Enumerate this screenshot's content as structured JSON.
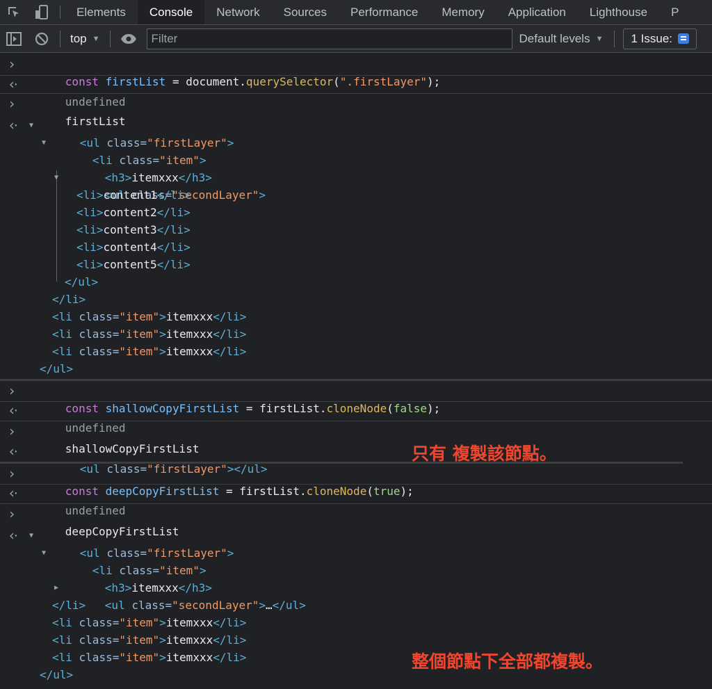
{
  "tabs": [
    {
      "id": "elements",
      "label": "Elements"
    },
    {
      "id": "console",
      "label": "Console"
    },
    {
      "id": "network",
      "label": "Network"
    },
    {
      "id": "sources",
      "label": "Sources"
    },
    {
      "id": "performance",
      "label": "Performance"
    },
    {
      "id": "memory",
      "label": "Memory"
    },
    {
      "id": "application",
      "label": "Application"
    },
    {
      "id": "lighthouse",
      "label": "Lighthouse"
    },
    {
      "id": "more",
      "label": "P"
    }
  ],
  "toolbar": {
    "context": "top",
    "filter_placeholder": "Filter",
    "levels": "Default levels",
    "issues": "1 Issue:"
  },
  "code": {
    "const": "const",
    "eq": " = ",
    "doc": "document",
    "dot": ".",
    "qs": "querySelector",
    "open": "(",
    "close": ");",
    "firstLayerStr": "\".firstLayer\"",
    "firstList": "firstList",
    "shallow": "shallowCopyFirstList",
    "deep": "deepCopyFirstList",
    "cloneNode": "cloneNode",
    "false": "false",
    "true": "true",
    "undefined": "undefined"
  },
  "dom": {
    "ul_open": "<ul",
    "li_open": "<li",
    "h3_open": "<h3>",
    "h3_close": "</h3>",
    "class_attr": " class=",
    "gt": ">",
    "ul_close": "</ul>",
    "li_close": "</li>",
    "li_simple": "<li>",
    "firstLayer": "\"firstLayer\"",
    "item": "\"item\"",
    "secondLayer": "\"secondLayer\"",
    "itemxxx": "itemxxx",
    "ellipsis": "…",
    "contents": [
      "content1",
      "content2",
      "content3",
      "content4",
      "content5"
    ]
  },
  "annotations": {
    "shallow": "只有 複製該節點。",
    "deep": "整個節點下全部都複製。"
  },
  "colors": {
    "tag": "#5db0d7",
    "attr": "#9bbbdc",
    "value": "#f29766",
    "keyword": "#c97bd8",
    "function": "#ddb763",
    "annotation": "#f0462f"
  }
}
